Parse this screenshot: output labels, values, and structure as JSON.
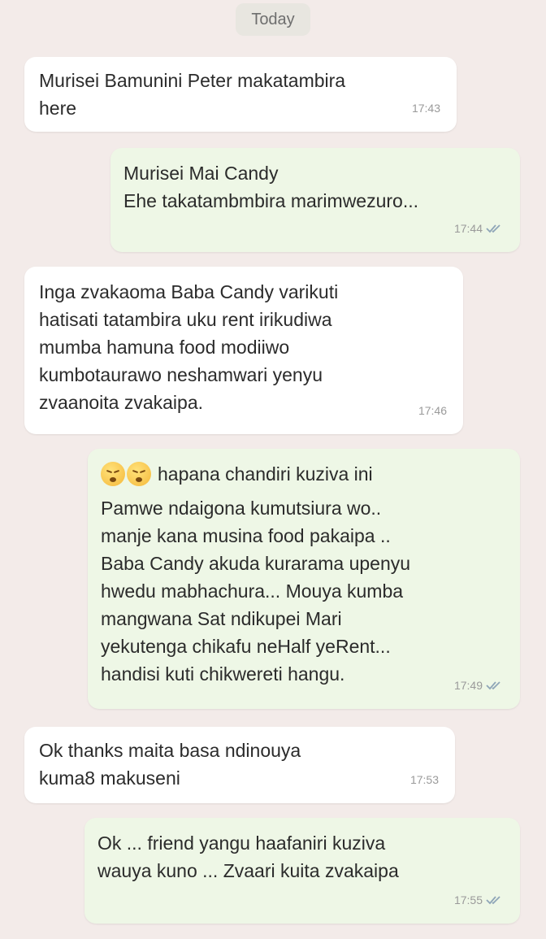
{
  "date_divider": "Today",
  "messages": [
    {
      "direction": "incoming",
      "text": "Murisei Bamunini Peter makatambira\nhere",
      "time": "17:43"
    },
    {
      "direction": "outgoing",
      "text": "Murisei Mai Candy\nEhe takatambmbira marimwezuro...",
      "time": "17:44",
      "status": "read"
    },
    {
      "direction": "incoming",
      "text": "Inga zvakaoma Baba Candy varikuti\nhatisati tatambira uku rent irikudiwa\nmumba hamuna food modiiwo\nkumbotaurawo neshamwari yenyu\nzvaanoita zvakaipa.",
      "time": "17:46"
    },
    {
      "direction": "outgoing",
      "emoji": [
        "sleepy-face-emoji",
        "sleepy-face-emoji"
      ],
      "first_line": "hapana chandiri kuziva ini",
      "text": "Pamwe ndaigona kumutsiura wo..\nmanje kana musina food pakaipa ..\nBaba Candy akuda kurarama upenyu\nhwedu mabhachura... Mouya kumba\nmangwana Sat ndikupei Mari\nyekutenga chikafu neHalf yeRent...\nhandisi kuti chikwereti hangu.",
      "time": "17:49",
      "status": "read"
    },
    {
      "direction": "incoming",
      "text": "Ok thanks maita basa ndinouya\nkuma8 makuseni",
      "time": "17:53"
    },
    {
      "direction": "outgoing",
      "text": "Ok ... friend yangu haafaniri kuziva\nwauya kuno ... Zvaari kuita zvakaipa",
      "time": "17:55",
      "status": "read"
    }
  ],
  "colors": {
    "incoming_bubble": "#ffffff",
    "outgoing_bubble": "#eef7e6",
    "background": "#f3ebe9",
    "read_tick": "#8fa6b8"
  }
}
